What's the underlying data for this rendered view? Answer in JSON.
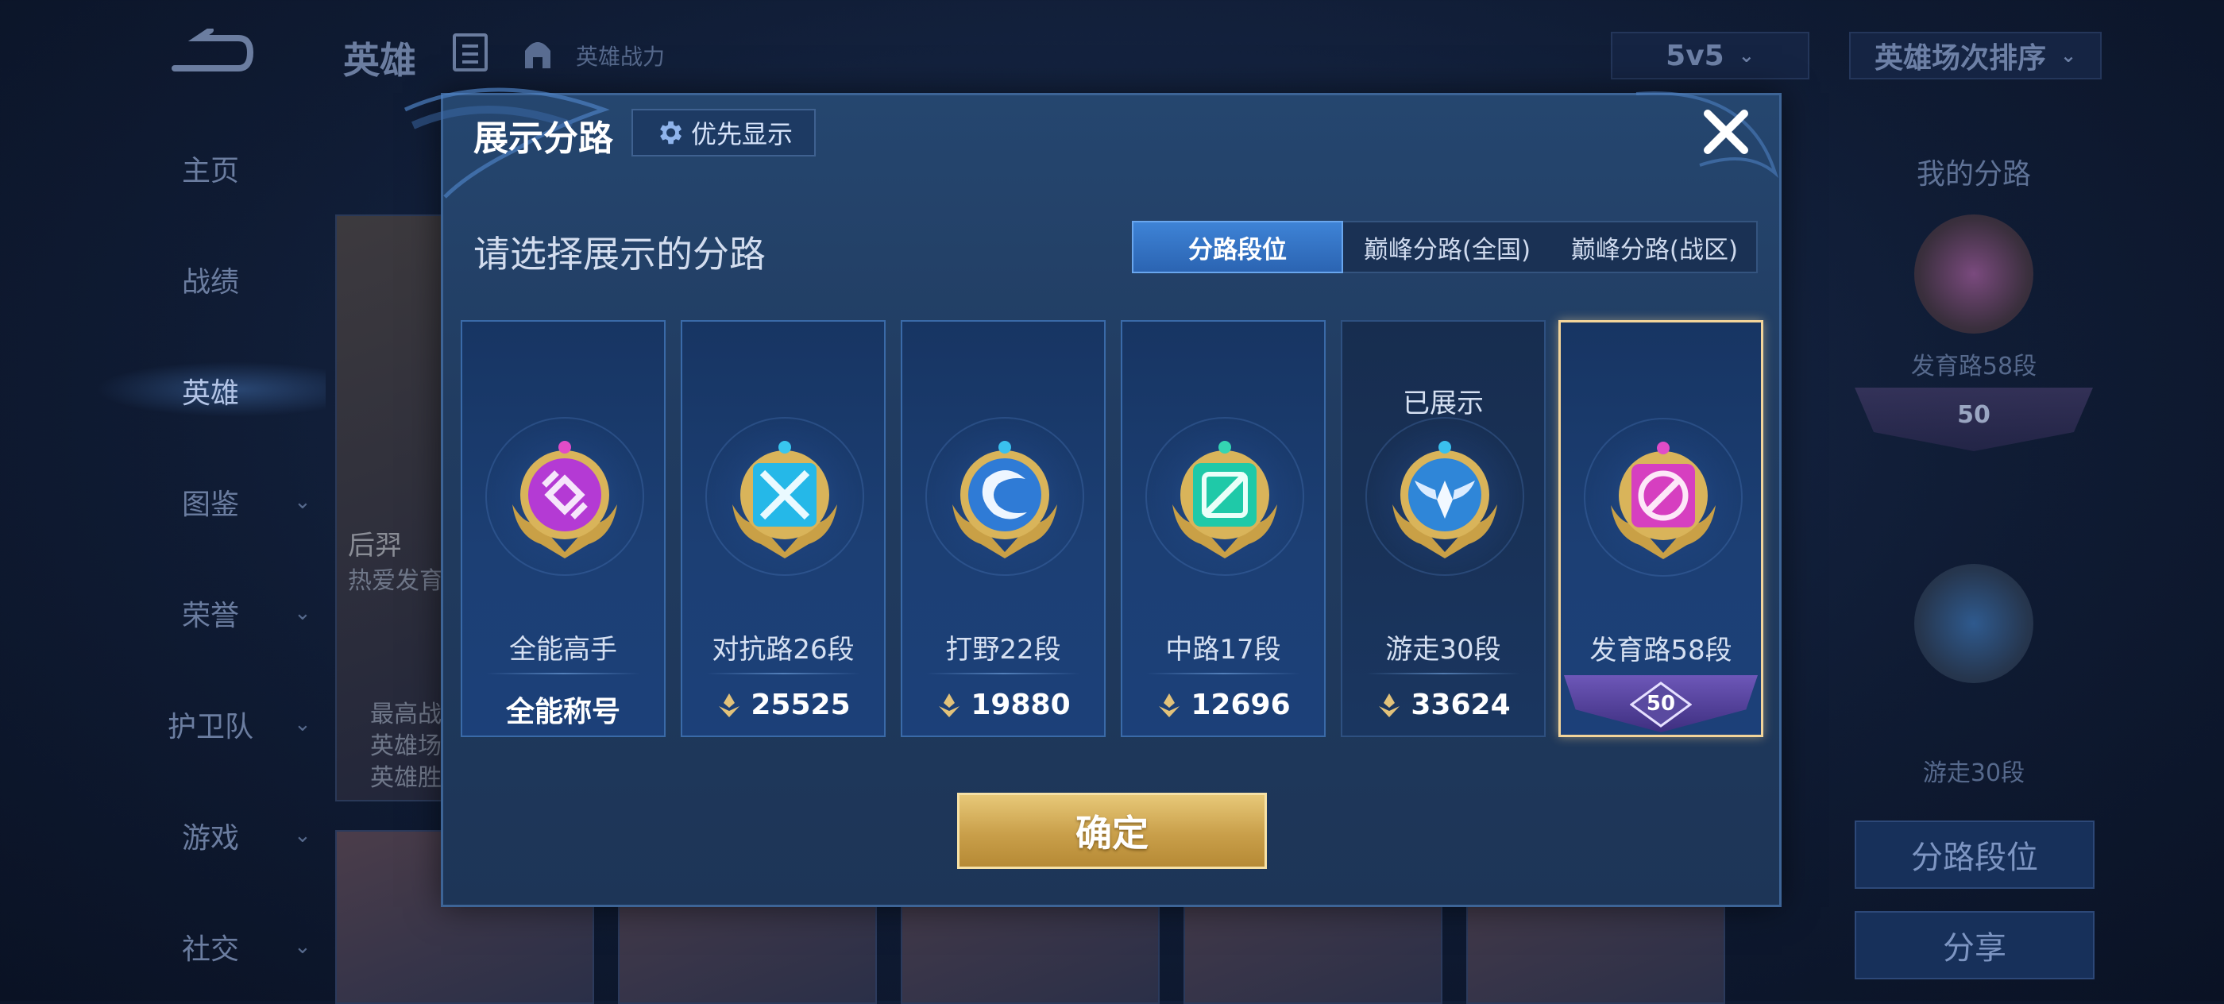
{
  "header": {
    "title": "英雄",
    "hero_power": "英雄战力",
    "mode_select": "5v5",
    "sort_select": "英雄场次排序"
  },
  "sidebar": {
    "items": [
      {
        "label": "主页",
        "has_chevron": false
      },
      {
        "label": "战绩",
        "has_chevron": false
      },
      {
        "label": "英雄",
        "has_chevron": false,
        "active": true
      },
      {
        "label": "图鉴",
        "has_chevron": true
      },
      {
        "label": "荣誉",
        "has_chevron": true
      },
      {
        "label": "护卫队",
        "has_chevron": true
      },
      {
        "label": "游戏",
        "has_chevron": true
      },
      {
        "label": "社交",
        "has_chevron": true
      }
    ]
  },
  "background_card": {
    "hero_name": "后羿",
    "hero_tag": "热爱发育",
    "stats": [
      "最高战",
      "英雄场",
      "英雄胜"
    ]
  },
  "right_panel": {
    "title": "我的分路",
    "lane1_label": "发育路58段",
    "lane1_level": "50",
    "lane2_label": "游走30段",
    "lane_rank_button": "分路段位",
    "share_button": "分享"
  },
  "modal": {
    "title": "展示分路",
    "priority_button": "优先显示",
    "subtitle": "请选择展示的分路",
    "tabs": [
      {
        "label": "分路段位",
        "active": true
      },
      {
        "label": "巅峰分路(全国)",
        "active": false
      },
      {
        "label": "巅峰分路(战区)",
        "active": false
      }
    ],
    "cards": [
      {
        "name": "全能高手",
        "value": "全能称号",
        "emblem": "allround-emblem-icon",
        "color": "#b43ad4"
      },
      {
        "name": "对抗路26段",
        "value": "25525",
        "emblem": "clash-lane-emblem-icon",
        "color": "#25b8e8"
      },
      {
        "name": "打野22段",
        "value": "19880",
        "emblem": "jungle-emblem-icon",
        "color": "#2f7bd6"
      },
      {
        "name": "中路17段",
        "value": "12696",
        "emblem": "mid-lane-emblem-icon",
        "color": "#1fc9a8"
      },
      {
        "name": "游走30段",
        "value": "33624",
        "emblem": "roam-emblem-icon",
        "color": "#2f86d8",
        "status": "已展示"
      },
      {
        "name": "发育路58段",
        "level": "50",
        "emblem": "farm-lane-emblem-icon",
        "color": "#d63fc0",
        "selected": true
      }
    ],
    "confirm_button": "确定"
  },
  "colors": {
    "modal_bg": "#213c61",
    "accent_blue": "#3e83d6",
    "gold": "#c99f4a",
    "selected_border": "#f2d49a"
  }
}
